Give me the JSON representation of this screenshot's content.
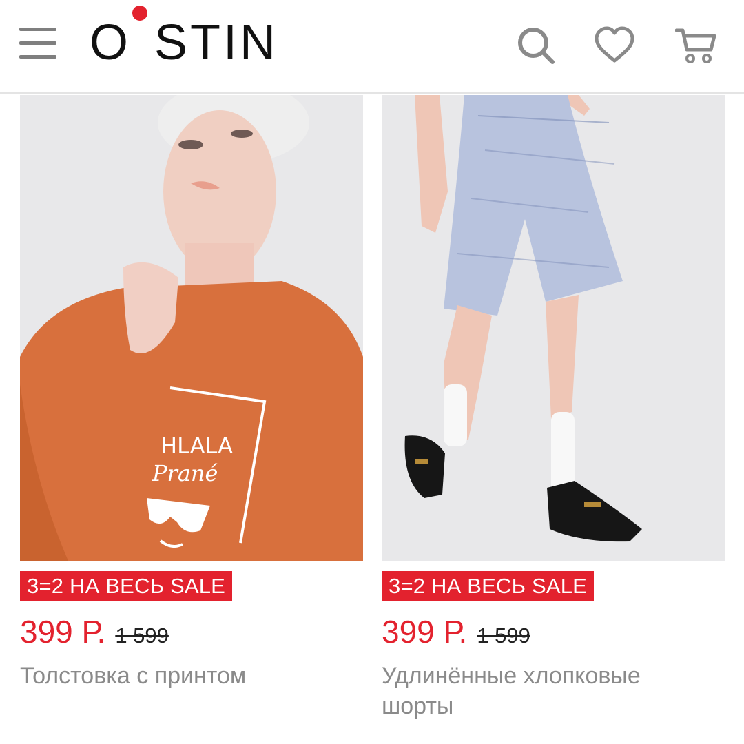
{
  "header": {
    "logo_text": "O°STIN",
    "logo_letters": "STIN",
    "logo_o": "O",
    "icons": [
      "menu-icon",
      "search-icon",
      "heart-icon",
      "cart-icon"
    ],
    "accent": "#e3222e"
  },
  "products": [
    {
      "promo": "3=2 НА ВЕСЬ SALE",
      "price": "399 Р.",
      "old_price": "1 599",
      "title": "Толстовка с принтом",
      "print_text_1": "HLALA",
      "print_text_2": "Prané"
    },
    {
      "promo": "3=2 НА ВЕСЬ SALE",
      "price": "399 Р.",
      "old_price": "1 599",
      "title": "Удлинённые хлопковые шорты"
    }
  ]
}
